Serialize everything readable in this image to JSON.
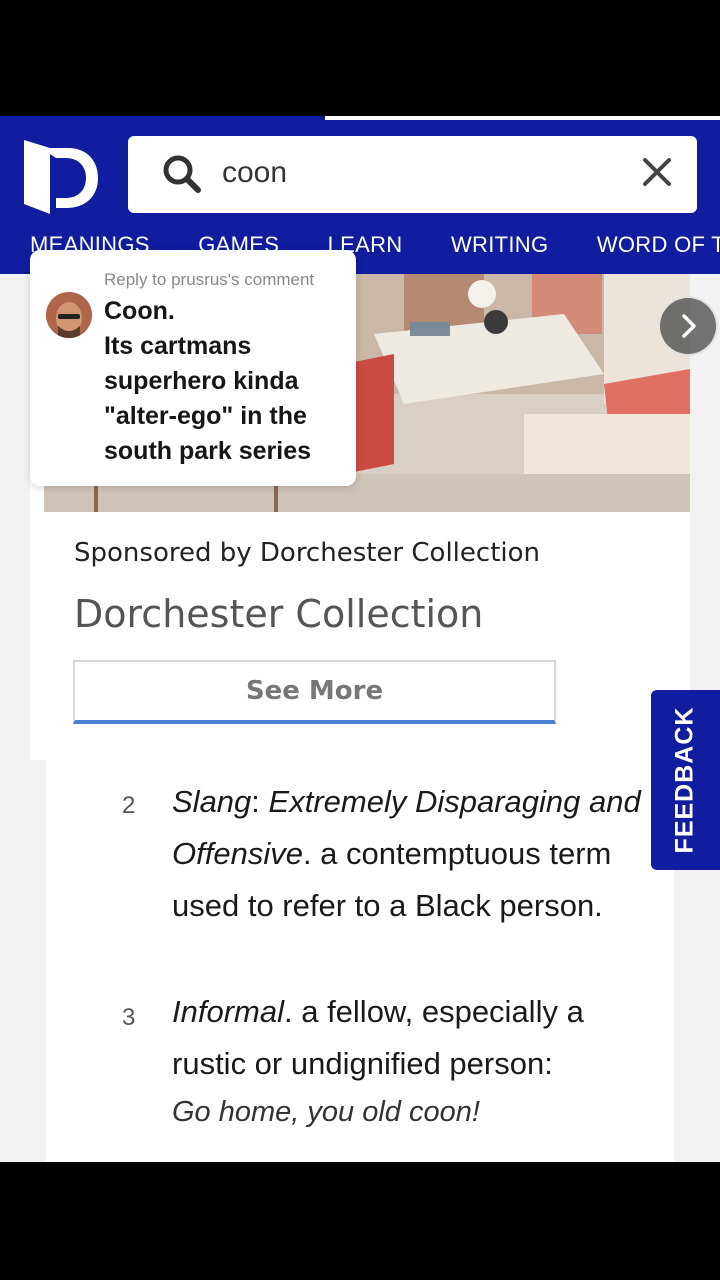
{
  "search": {
    "query": "coon"
  },
  "nav": {
    "items": [
      "MEANINGS",
      "GAMES",
      "LEARN",
      "WRITING",
      "WORD OF THE DAY"
    ]
  },
  "ad": {
    "sponsored_text": "Sponsored by Dorchester Collection",
    "title": "Dorchester Collection",
    "cta_label": "See More"
  },
  "overlay_comment": {
    "reply_to": "Reply to prusrus's comment",
    "lines": [
      "Coon.",
      "Its cartmans",
      "superhero kinda",
      "\"alter-ego\" in the",
      "south park series"
    ]
  },
  "definitions": [
    {
      "number": "2",
      "label_italic": "Slang",
      "sep": ": ",
      "qualifier_italic": "Extremely Disparaging and Offensive",
      "text": ". a contemptuous term used to refer to a Black person."
    },
    {
      "number": "3",
      "label_italic": "Informal",
      "text": ". a fellow, especially a rustic or undignified person:",
      "example": "Go home, you old coon!"
    }
  ],
  "feedback": {
    "label": "FEEDBACK"
  },
  "colors": {
    "brand_blue": "#0f1d9e",
    "cta_underline": "#4a7fd4"
  },
  "icons": [
    "dictionary-logo-icon",
    "search-icon",
    "clear-icon",
    "chevron-right-icon"
  ]
}
